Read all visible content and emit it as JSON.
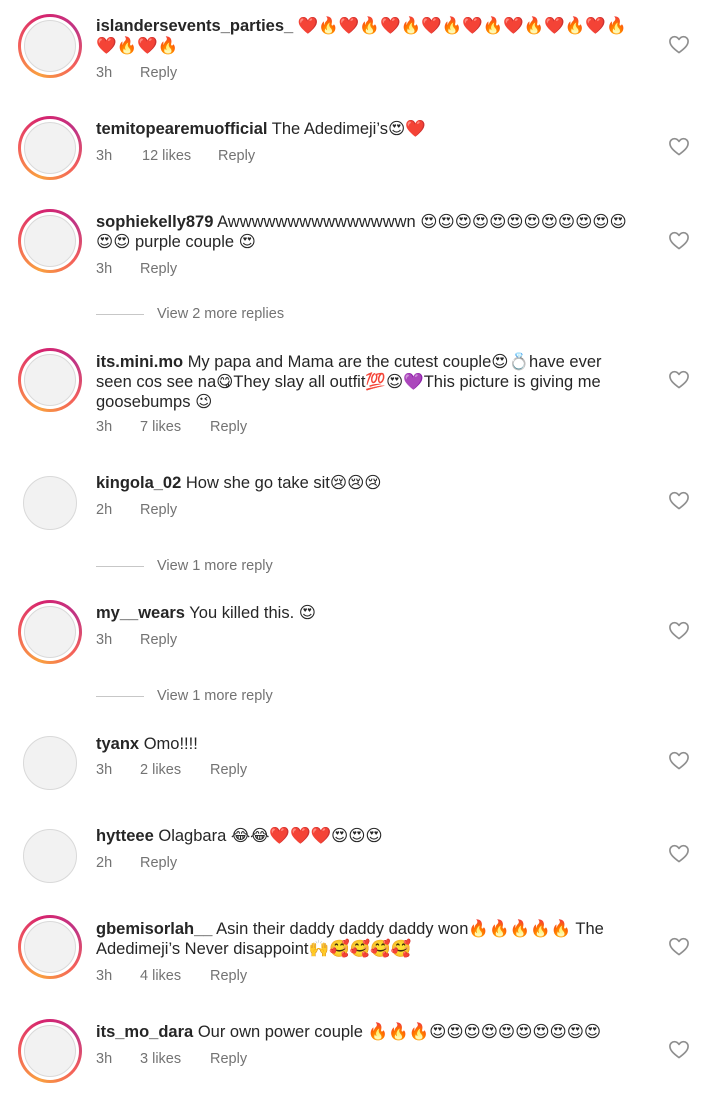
{
  "comments": [
    {
      "username": "islandersevents_parties_",
      "text": "❤️🔥❤️🔥❤️🔥❤️🔥❤️🔥❤️🔥❤️🔥❤️🔥❤️🔥❤️🔥",
      "time": "3h",
      "likes": "",
      "reply": "Reply",
      "story": true
    },
    {
      "username": "temitopearemuofficial",
      "text": "The Adedimeji’s😍❤️",
      "time": "3h",
      "likes": "12 likes",
      "reply": "Reply",
      "story": true
    },
    {
      "username": "sophiekelly879",
      "text": "Awwwwwwwwwwwwwwwn 😍😍😍😍😍😍😍😍😍😍😍😍😍😍 purple couple 😍",
      "time": "3h",
      "likes": "",
      "reply": "Reply",
      "story": true
    },
    {
      "username": "its.mini.mo",
      "text": "My papa and Mama are the cutest couple😍💍have ever seen cos see na😋They slay all outfit💯😍💜This picture is giving me goosebumps 😉",
      "time": "3h",
      "likes": "7 likes",
      "reply": "Reply",
      "story": true
    },
    {
      "username": "kingola_02",
      "text": "How she go take sit😢😢😢",
      "time": "2h",
      "likes": "",
      "reply": "Reply",
      "story": false
    },
    {
      "username": "my__wears",
      "text": "You killed this. 😍",
      "time": "3h",
      "likes": "",
      "reply": "Reply",
      "story": true
    },
    {
      "username": "tyanx",
      "text": "Omo!!!!",
      "time": "3h",
      "likes": "2 likes",
      "reply": "Reply",
      "story": false
    },
    {
      "username": "hytteee",
      "text": "Olagbara 😂😂❤️❤️❤️😍😍😍",
      "time": "2h",
      "likes": "",
      "reply": "Reply",
      "story": false
    },
    {
      "username": "gbemisorlah__",
      "text": "Asin their daddy daddy daddy won🔥🔥🔥🔥🔥 The Adedimeji’s Never disappoint🙌🥰🥰🥰🥰",
      "time": "3h",
      "likes": "4 likes",
      "reply": "Reply",
      "story": true
    },
    {
      "username": "its_mo_dara",
      "text": "Our own power couple 🔥🔥🔥😍😍😍😍😍😍😍😍😍😍",
      "time": "3h",
      "likes": "3 likes",
      "reply": "Reply",
      "story": true
    }
  ],
  "view_replies": [
    "View 2 more replies",
    "View 1 more reply",
    "View 1 more reply"
  ],
  "colors": {
    "text": "#262626",
    "secondary": "#737373",
    "story_ring": "#d6246e"
  },
  "icons": {
    "like": "heart-outline-icon"
  }
}
